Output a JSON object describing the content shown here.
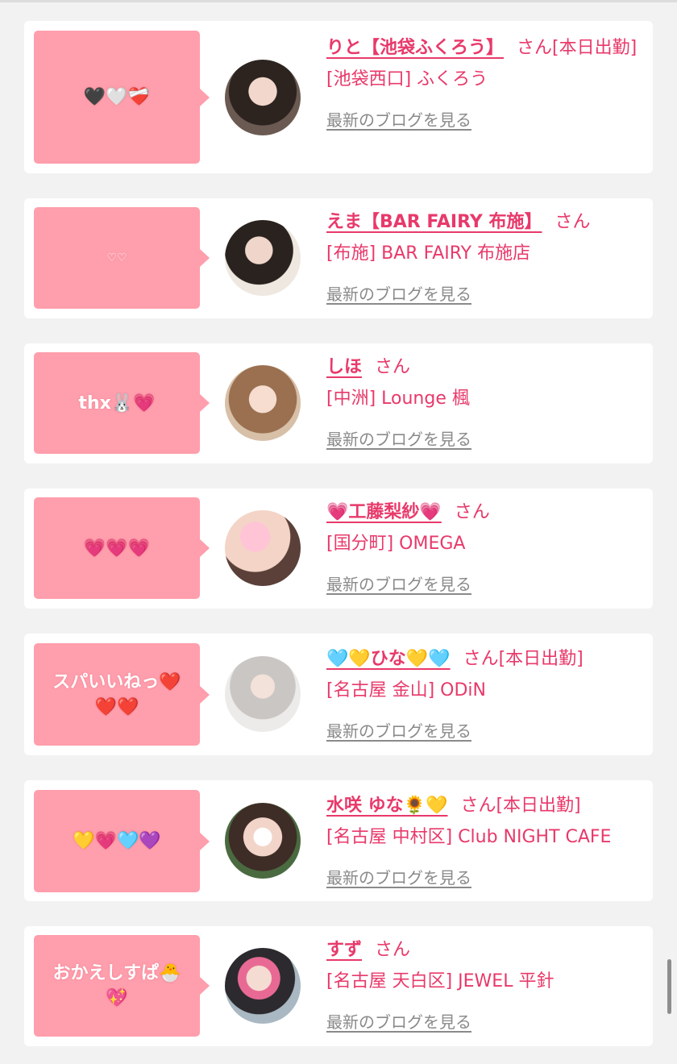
{
  "posts": [
    {
      "comment": "🖤🤍❤️‍🩹",
      "name": "りと【池袋ふくろう】",
      "san": "さん[本日出勤]",
      "shop": "[池袋西口] ふくろう",
      "blog": "最新のブログを見る"
    },
    {
      "comment": "♡♡",
      "name": "えま【BAR FAIRY 布施】",
      "san": "さん",
      "shop": "[布施] BAR FAIRY 布施店",
      "blog": "最新のブログを見る"
    },
    {
      "comment": "thx🐰💗",
      "name": "しほ",
      "san": "さん",
      "shop": "[中洲] Lounge 楓",
      "blog": "最新のブログを見る"
    },
    {
      "comment": "💗💗💗",
      "name": "💗工藤梨紗💗",
      "san": "さん",
      "shop": "[国分町] OMEGA",
      "blog": "最新のブログを見る"
    },
    {
      "comment": "スパいいねっ❤️❤️❤️",
      "name": "🩵💛ひな💛🩵",
      "san": "さん[本日出勤]",
      "shop": "[名古屋 金山] ODiN",
      "blog": "最新のブログを見る"
    },
    {
      "comment": "💛💗🩵💜",
      "name": "水咲 ゆな🌻💛",
      "san": "さん[本日出勤]",
      "shop": "[名古屋 中村区] Club NIGHT CAFE",
      "blog": "最新のブログを見る"
    },
    {
      "comment": "おかえしすぱ🐣💖",
      "name": "すず",
      "san": "さん",
      "shop": "[名古屋 天白区] JEWEL 平針",
      "blog": "最新のブログを見る"
    }
  ]
}
